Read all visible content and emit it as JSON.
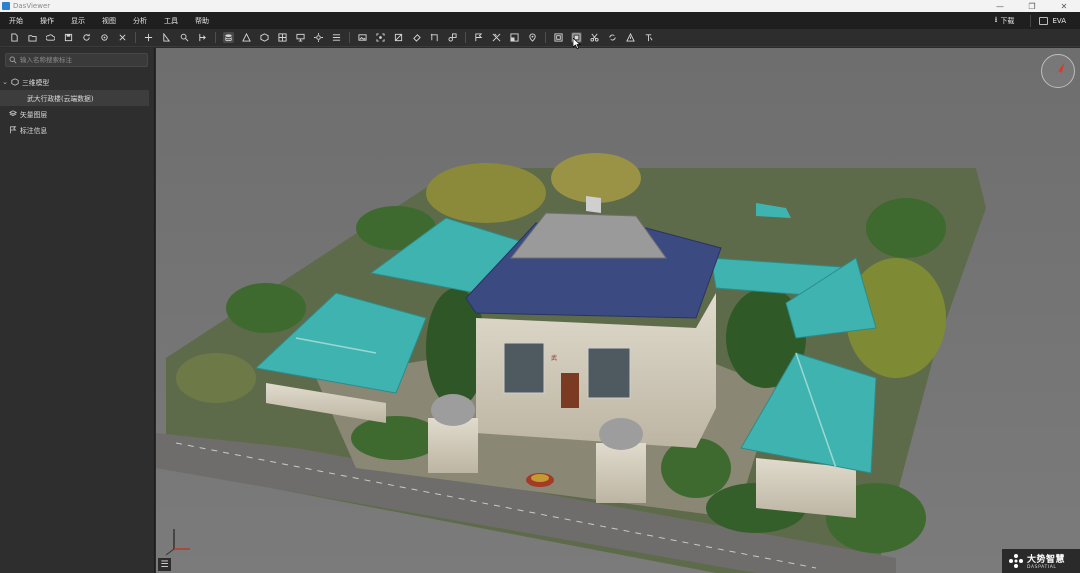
{
  "window": {
    "title": "DasViewer",
    "minimize": "—",
    "maximize": "❐",
    "close": "✕"
  },
  "menu": {
    "items": [
      "开始",
      "操作",
      "显示",
      "视图",
      "分析",
      "工具",
      "帮助"
    ]
  },
  "header": {
    "download_label": "下载",
    "user_name": "EVA"
  },
  "toolbar": {
    "icons": [
      "new-file-icon",
      "open-folder-icon",
      "cloud-icon",
      "save-icon",
      "refresh-icon",
      "settings-icon",
      "close-icon",
      "move-icon",
      "measure-icon",
      "search-icon",
      "annotate-icon",
      "layers-icon",
      "triangle-icon",
      "cube-icon",
      "grid-icon",
      "display-icon",
      "light-icon",
      "list-icon",
      "image-icon",
      "focus-icon",
      "crop-icon",
      "fill-icon",
      "select-icon",
      "shape-icon",
      "flag-icon",
      "cut-icon",
      "texture-icon",
      "location-icon",
      "frame-icon",
      "screenshot-icon",
      "scissors-icon",
      "sync-icon",
      "warning-icon",
      "text-icon"
    ]
  },
  "sidebar": {
    "search_placeholder": "输入名称搜索标注",
    "tree": [
      {
        "label": "三维模型",
        "icon": "cube-icon",
        "expanded": true
      },
      {
        "label": "武大行政楼(云端数据)",
        "selected": true
      },
      {
        "label": "矢量图层",
        "icon": "layers-icon"
      },
      {
        "label": "标注信息",
        "icon": "flag-icon"
      }
    ]
  },
  "viewport": {
    "background": "#747474",
    "brand_cn": "大势智慧",
    "brand_en": "DASPATIAL",
    "expand_icon": "☰"
  },
  "colors": {
    "roof_teal": "#3fb3b0",
    "roof_blue": "#3c4a82",
    "wall": "#d9d3c3",
    "tree_green": "#3d6b30",
    "accent_red": "#d63c2d"
  }
}
